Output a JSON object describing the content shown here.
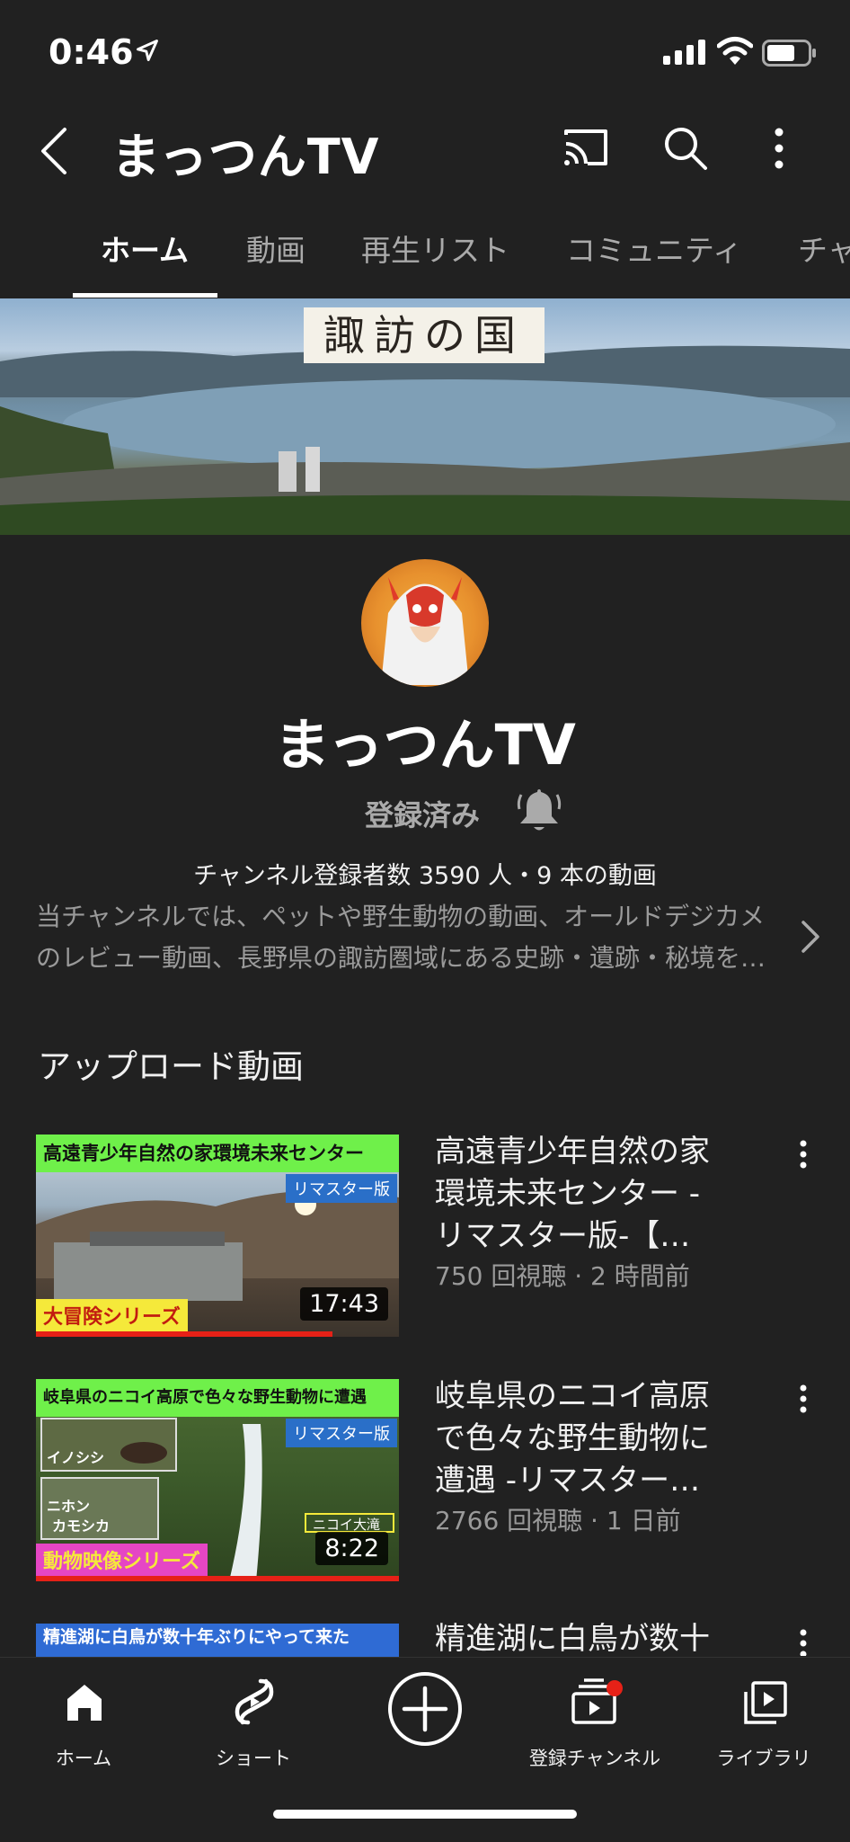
{
  "status_bar": {
    "time": "0:46"
  },
  "header": {
    "title": "まっつんTV"
  },
  "tabs": [
    {
      "label": "ホーム"
    },
    {
      "label": "動画"
    },
    {
      "label": "再生リスト"
    },
    {
      "label": "コミュニティ"
    },
    {
      "label": "チャ"
    }
  ],
  "banner": {
    "text": "諏訪の国"
  },
  "channel": {
    "name": "まっつんTV",
    "subscribed_label": "登録済み",
    "stats": "チャンネル登録者数 3590 人・9 本の動画",
    "description_lines": [
      "当チャンネルでは、ペットや野生動物の動画、オールドデジカメ",
      "のレビュー動画、長野県の諏訪圏域にある史跡・遺跡・秘境を…"
    ]
  },
  "uploads": {
    "heading": "アップロード動画",
    "videos": [
      {
        "thumb_banner": "高遠青少年自然の家環境未来センター",
        "remaster": "リマスター版",
        "series": "大冒険シリーズ",
        "duration": "17:43",
        "title_lines": [
          "高遠青少年自然の家",
          "環境未来センター -",
          "リマスター版-【…"
        ],
        "meta": "750 回視聴 · 2 時間前"
      },
      {
        "thumb_banner": "岐阜県のニコイ高原で色々な野生動物に遭遇",
        "remaster": "リマスター版",
        "series": "動物映像シリーズ",
        "labels": [
          "イノシシ",
          "ニホン",
          "カモシカ",
          "ニコイ大滝"
        ],
        "duration": "8:22",
        "title_lines": [
          "岐阜県のニコイ高原",
          "で色々な野生動物に",
          "遭遇 -リマスター…"
        ],
        "meta": "2766 回視聴 · 1 日前"
      },
      {
        "thumb_banner": "精進湖に白鳥が数十年ぶりにやって来た",
        "title_lines": [
          "精進湖に白鳥が数十"
        ]
      }
    ]
  },
  "bottom_nav": [
    {
      "label": "ホーム"
    },
    {
      "label": "ショート"
    },
    {
      "label": ""
    },
    {
      "label": "登録チャンネル"
    },
    {
      "label": "ライブラリ"
    }
  ],
  "colors": {
    "background": "#212121",
    "accent_red": "#e62117",
    "thumb_banner_green": "#6ff04a"
  }
}
